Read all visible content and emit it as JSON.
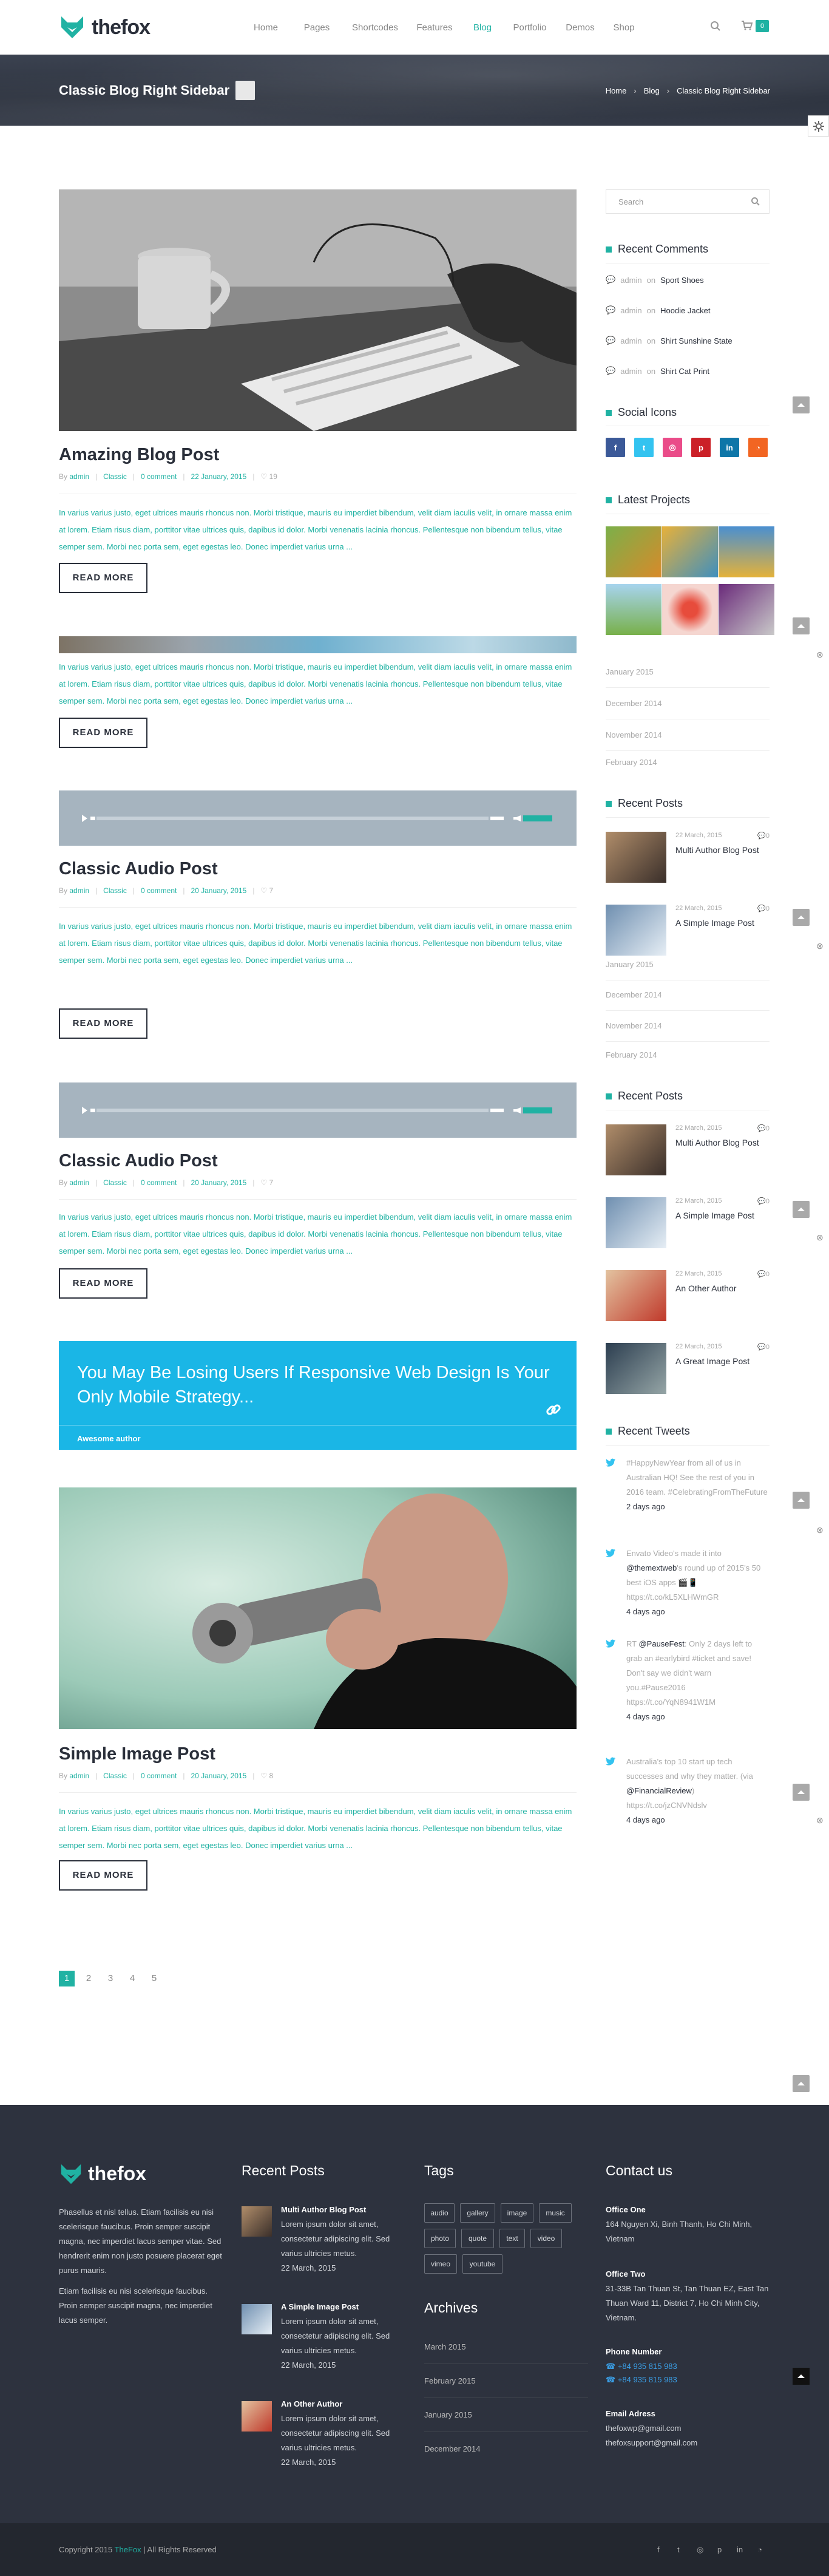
{
  "header": {
    "brand": "thefox",
    "nav": [
      "Home",
      "Pages",
      "Shortcodes",
      "Features",
      "Blog",
      "Portfolio",
      "Demos",
      "Shop"
    ],
    "active_nav": "Blog",
    "cart_count": "0",
    "accent": "#20b2a3"
  },
  "titlebar": {
    "title": "Classic Blog Right Sidebar",
    "breadcrumb": [
      "Home",
      "Blog",
      "Classic Blog Right Sidebar"
    ],
    "separator": "›"
  },
  "posts": [
    {
      "title": "Amazing Blog Post",
      "author_prefix": "By",
      "author": "admin",
      "category": "Classic",
      "comments": "0 comment",
      "date": "22 January, 2015",
      "likes": "19",
      "excerpt": "In varius varius justo, eget ultrices mauris rhoncus non. Morbi tristique, mauris eu imperdiet bibendum, velit diam iaculis velit, in ornare massa enim at lorem. Etiam risus diam, porttitor vitae ultrices quis, dapibus id dolor. Morbi venenatis lacinia rhoncus. Pellentesque non bibendum tellus, vitae semper sem. Morbi nec porta sem, eget egestas leo. Donec imperdiet varius urna ...",
      "read_more": "READ MORE"
    },
    {
      "excerpt": "In varius varius justo, eget ultrices mauris rhoncus non. Morbi tristique, mauris eu imperdiet bibendum, velit diam iaculis velit, in ornare massa enim at lorem. Etiam risus diam, porttitor vitae ultrices quis, dapibus id dolor. Morbi venenatis lacinia rhoncus. Pellentesque non bibendum tellus, vitae semper sem. Morbi nec porta sem, eget egestas leo. Donec imperdiet varius urna ...",
      "read_more": "READ MORE"
    },
    {
      "title": "Classic Audio Post",
      "author_prefix": "By",
      "author": "admin",
      "category": "Classic",
      "comments": "0 comment",
      "date": "20 January, 2015",
      "likes": "7",
      "excerpt": "In varius varius justo, eget ultrices mauris rhoncus non. Morbi tristique, mauris eu imperdiet bibendum, velit diam iaculis velit, in ornare massa enim at lorem. Etiam risus diam, porttitor vitae ultrices quis, dapibus id dolor. Morbi venenatis lacinia rhoncus. Pellentesque non bibendum tellus, vitae semper sem. Morbi nec porta sem, eget egestas leo. Donec imperdiet varius urna ...",
      "read_more": "READ MORE"
    },
    {
      "title": "Classic Audio Post",
      "author_prefix": "By",
      "author": "admin",
      "category": "Classic",
      "comments": "0 comment",
      "date": "20 January, 2015",
      "likes": "7",
      "excerpt": "In varius varius justo, eget ultrices mauris rhoncus non. Morbi tristique, mauris eu imperdiet bibendum, velit diam iaculis velit, in ornare massa enim at lorem. Etiam risus diam, porttitor vitae ultrices quis, dapibus id dolor. Morbi venenatis lacinia rhoncus. Pellentesque non bibendum tellus, vitae semper sem. Morbi nec porta sem, eget egestas leo. Donec imperdiet varius urna ...",
      "read_more": "READ MORE"
    },
    {
      "title": "Simple Image Post",
      "author_prefix": "By",
      "author": "admin",
      "category": "Classic",
      "comments": "0 comment",
      "date": "20 January, 2015",
      "likes": "8",
      "excerpt": "In varius varius justo, eget ultrices mauris rhoncus non. Morbi tristique, mauris eu imperdiet bibendum, velit diam iaculis velit, in ornare massa enim at lorem. Etiam risus diam, porttitor vitae ultrices quis, dapibus id dolor. Morbi venenatis lacinia rhoncus. Pellentesque non bibendum tellus, vitae semper sem. Morbi nec porta sem, eget egestas leo. Donec imperdiet varius urna ...",
      "read_more": "READ MORE"
    }
  ],
  "quote_post": {
    "text": "You May Be Losing Users If Responsive Web Design Is Your Only Mobile Strategy...",
    "author": "Awesome author",
    "color": "#1ab6e6"
  },
  "pagination": [
    "1",
    "2",
    "3",
    "4",
    "5"
  ],
  "sidebar": {
    "search_placeholder": "Search",
    "recent_comments": {
      "heading": "Recent Comments",
      "items": [
        {
          "author": "admin",
          "on": "on",
          "target": "Sport Shoes"
        },
        {
          "author": "admin",
          "on": "on",
          "target": "Hoodie Jacket"
        },
        {
          "author": "admin",
          "on": "on",
          "target": "Shirt Sunshine State"
        },
        {
          "author": "admin",
          "on": "on",
          "target": "Shirt Cat Print"
        }
      ]
    },
    "social": {
      "heading": "Social Icons",
      "icons": [
        {
          "name": "facebook-icon",
          "glyph": "f",
          "color": "#3b5998"
        },
        {
          "name": "twitter-icon",
          "glyph": "t",
          "color": "#33c3f0"
        },
        {
          "name": "dribbble-icon",
          "glyph": "◎",
          "color": "#ea4c89"
        },
        {
          "name": "pinterest-icon",
          "glyph": "p",
          "color": "#cb2027"
        },
        {
          "name": "linkedin-icon",
          "glyph": "in",
          "color": "#0e76a8"
        },
        {
          "name": "rss-icon",
          "glyph": "◔",
          "color": "#f26522"
        }
      ]
    },
    "latest_projects": {
      "heading": "Latest Projects"
    },
    "archives_1": [
      "January 2015",
      "December 2014",
      "November 2014",
      "February 2014"
    ],
    "recent_posts_1": {
      "heading": "Recent Posts",
      "items": [
        {
          "date": "22 March, 2015",
          "comments": "0",
          "title": "Multi Author Blog Post"
        },
        {
          "date": "22 March, 2015",
          "comments": "0",
          "title": "A Simple Image Post"
        }
      ]
    },
    "archives_2": [
      "January 2015",
      "December 2014",
      "November 2014",
      "February 2014"
    ],
    "recent_posts_2": {
      "heading": "Recent Posts",
      "items": [
        {
          "date": "22 March, 2015",
          "comments": "0",
          "title": "Multi Author Blog Post"
        },
        {
          "date": "22 March, 2015",
          "comments": "0",
          "title": "A Simple Image Post"
        },
        {
          "date": "22 March, 2015",
          "comments": "0",
          "title": "An Other Author"
        },
        {
          "date": "22 March, 2015",
          "comments": "0",
          "title": "A Great Image Post"
        }
      ]
    },
    "recent_tweets": {
      "heading": "Recent Tweets",
      "items": [
        {
          "text": "#HappyNewYear from all of us in Australian HQ! See the rest of you in 2016 team. #CelebratingFromTheFuture",
          "ago": "2 days ago"
        },
        {
          "text_a": "Envato Video's made it into ",
          "handle": "@themextweb",
          "text_b": "'s round up of 2015's 50 best iOS apps 🎬📱 https://t.co/kL5XLHWmGR",
          "ago": "4 days ago"
        },
        {
          "text_a": "RT ",
          "handle": "@PauseFest",
          "text_b": ": Only 2 days left to grab an #earlybird #ticket and save! Don't say we didn't warn you.#Pause2016 https://t.co/YqN8941W1M",
          "ago": "4 days ago"
        },
        {
          "text_a": "Australia's top 10 start up tech successes and why they matter. (via ",
          "handle": "@FinancialReview",
          "text_b": ") https://t.co/jzCNVNdslv",
          "ago": "4 days ago"
        }
      ]
    }
  },
  "footer": {
    "brand": "thefox",
    "about_1": "Phasellus et nisl tellus. Etiam facilisis eu nisi scelerisque faucibus. Proin semper suscipit magna, nec imperdiet lacus semper vitae. Sed hendrerit enim non justo posuere placerat eget purus mauris.",
    "about_2": "Etiam facilisis eu nisi scelerisque faucibus. Proin semper suscipit magna, nec imperdiet lacus semper.",
    "recent_posts_heading": "Recent Posts",
    "recent_posts": [
      {
        "title": "Multi Author Blog Post",
        "text": "Lorem ipsum dolor sit amet, consectetur adipiscing elit. Sed varius ultricies metus.",
        "date": "22 March, 2015"
      },
      {
        "title": "A Simple Image Post",
        "text": "Lorem ipsum dolor sit amet, consectetur adipiscing elit. Sed varius ultricies metus.",
        "date": "22 March, 2015"
      },
      {
        "title": "An Other Author",
        "text": "Lorem ipsum dolor sit amet, consectetur adipiscing elit. Sed varius ultricies metus.",
        "date": "22 March, 2015"
      }
    ],
    "tags_heading": "Tags",
    "tags": [
      "audio",
      "gallery",
      "image",
      "music",
      "photo",
      "quote",
      "text",
      "video",
      "vimeo",
      "youtube"
    ],
    "archives_heading": "Archives",
    "archives": [
      "March 2015",
      "February 2015",
      "January 2015",
      "December 2014"
    ],
    "contact_heading": "Contact us",
    "office_one_label": "Office One",
    "office_one": "164 Nguyen Xi, Binh Thanh, Ho Chi Minh, Vietnam",
    "office_two_label": "Office Two",
    "office_two": "31-33B Tan Thuan St, Tan Thuan EZ, East Tan Thuan Ward 11, District 7, Ho Chi Minh City, Vietnam.",
    "phone_label": "Phone Number",
    "phone_1": "+84 935 815 983",
    "phone_2": "+84 935 815 983",
    "email_label": "Email Adress",
    "email_1": "thefoxwp@gmail.com",
    "email_2": "thefoxsupport@gmail.com"
  },
  "bottom_bar": {
    "copyright_prefix": "Copyright 2015",
    "brand": "TheFox",
    "copyright_suffix": "| All Rights Reserved",
    "social": [
      "f",
      "t",
      "◎",
      "p",
      "in",
      "◔"
    ]
  }
}
